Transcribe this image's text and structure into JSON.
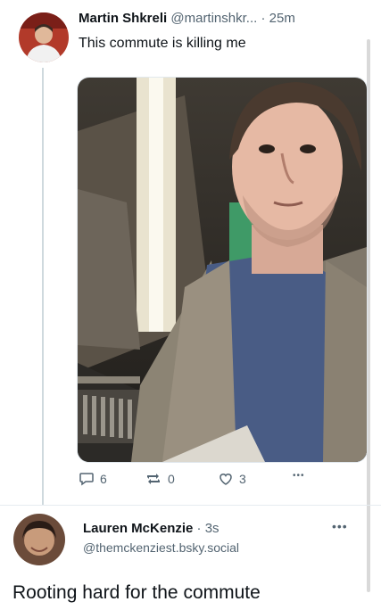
{
  "post1": {
    "author_name": "Martin Shkreli",
    "author_handle": "@martinshkr...",
    "separator": "·",
    "time": "25m",
    "text": "This commute is killing me",
    "actions": {
      "reply_count": "6",
      "repost_count": "0",
      "like_count": "3",
      "more_label": "•••"
    }
  },
  "post2": {
    "author_name": "Lauren McKenzie",
    "separator": "·",
    "time": "3s",
    "author_handle": "@themckenziest.bsky.social",
    "more_label": "•••",
    "text": "Rooting hard for the commute"
  },
  "colors": {
    "text_primary": "#0f1419",
    "text_secondary": "#536471",
    "divider": "#e6ecf0"
  },
  "icons": [
    "reply-icon",
    "repost-icon",
    "like-icon",
    "more-icon"
  ]
}
